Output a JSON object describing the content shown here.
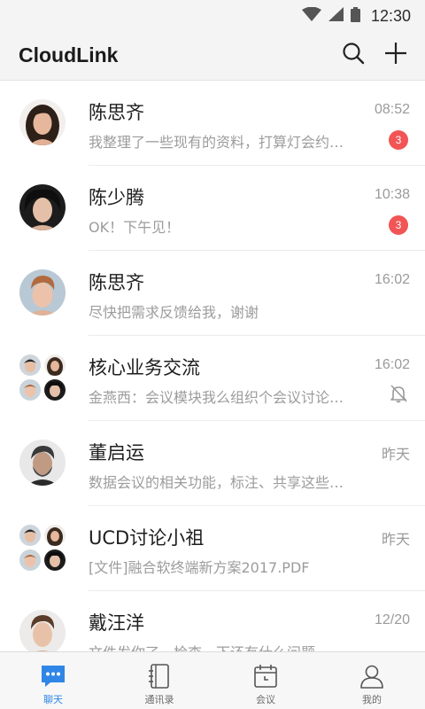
{
  "status_bar": {
    "time": "12:30"
  },
  "app_bar": {
    "title": "CloudLink",
    "search_icon": "search-icon",
    "add_icon": "plus-icon"
  },
  "colors": {
    "accent": "#2f86e6",
    "badge": "#f25555",
    "secondary_text": "#9c9c9c"
  },
  "chats": [
    {
      "name": "陈思齐",
      "time": "08:52",
      "preview": "我整理了一些现有的资料，打算灯会约…",
      "badge": "3",
      "avatar": "portrait-woman"
    },
    {
      "name": "陈少腾",
      "time": "10:38",
      "preview": "OK！下午见！",
      "badge": "3",
      "avatar": "portrait-man-curly"
    },
    {
      "name": "陈思齐",
      "time": "16:02",
      "preview": "尽快把需求反馈给我，谢谢",
      "avatar": "portrait-man-ginger"
    },
    {
      "name": "核心业务交流",
      "time": "16:02",
      "preview": "金燕西：会议模块我么组织个会议讨论…",
      "muted": true,
      "avatar": "group"
    },
    {
      "name": "董启运",
      "time": "昨天",
      "preview": "数据会议的相关功能，标注、共享这些…",
      "avatar": "portrait-man-beard"
    },
    {
      "name": "UCD讨论小祖",
      "time": "昨天",
      "preview": "[文件]融合软终端新方案2017.PDF",
      "avatar": "group"
    },
    {
      "name": "戴汪洋",
      "time": "12/20",
      "preview": "文件发你了，检查一下还有什么问题",
      "avatar": "portrait-man-young"
    }
  ],
  "tabs": [
    {
      "label": "聊天",
      "icon": "chat-bubble-icon",
      "active": true
    },
    {
      "label": "通讯录",
      "icon": "contacts-book-icon"
    },
    {
      "label": "会议",
      "icon": "calendar-icon"
    },
    {
      "label": "我的",
      "icon": "person-icon"
    }
  ]
}
